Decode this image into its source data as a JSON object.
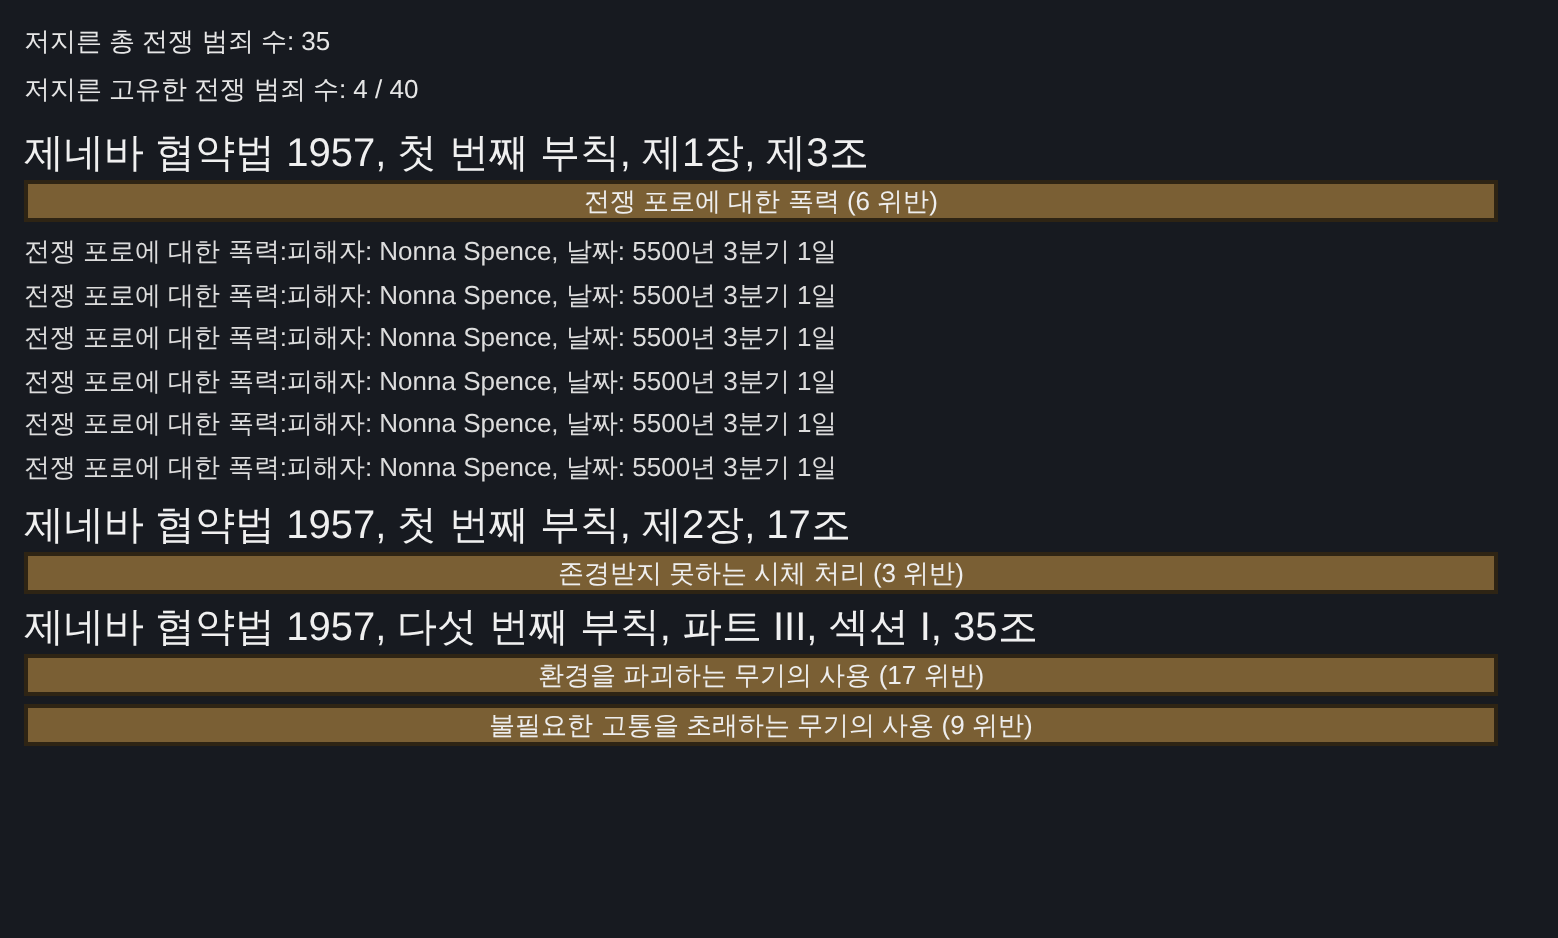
{
  "stats": [
    "저지른 총 전쟁 범죄 수: 35",
    "저지른 고유한 전쟁 범죄 수: 4 / 40"
  ],
  "sections": [
    {
      "title": "제네바 협약법 1957, 첫 번째 부칙, 제1장, 제3조",
      "crimes": [
        {
          "label": "전쟁 포로에 대한 폭력 (6 위반)",
          "entries": [
            "전쟁 포로에 대한 폭력:피해자: Nonna Spence, 날짜: 5500년 3분기 1일",
            "전쟁 포로에 대한 폭력:피해자: Nonna Spence, 날짜: 5500년 3분기 1일",
            "전쟁 포로에 대한 폭력:피해자: Nonna Spence, 날짜: 5500년 3분기 1일",
            "전쟁 포로에 대한 폭력:피해자: Nonna Spence, 날짜: 5500년 3분기 1일",
            "전쟁 포로에 대한 폭력:피해자: Nonna Spence, 날짜: 5500년 3분기 1일",
            "전쟁 포로에 대한 폭력:피해자: Nonna Spence, 날짜: 5500년 3분기 1일"
          ]
        }
      ]
    },
    {
      "title": "제네바 협약법 1957, 첫 번째 부칙, 제2장, 17조",
      "crimes": [
        {
          "label": "존경받지 못하는 시체 처리 (3 위반)"
        }
      ]
    },
    {
      "title": "제네바 협약법 1957, 다섯 번째 부칙, 파트 III, 섹션 I, 35조",
      "crimes": [
        {
          "label": "환경을 파괴하는 무기의 사용 (17 위반)"
        },
        {
          "label": "불필요한 고통을 초래하는 무기의 사용 (9 위반)"
        }
      ]
    }
  ]
}
